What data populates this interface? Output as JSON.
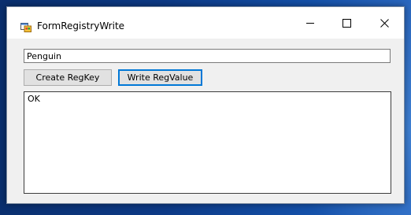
{
  "window": {
    "title": "FormRegistryWrite",
    "icon": "windows-form-icon",
    "controls": {
      "minimize": "minimize-icon",
      "maximize": "maximize-icon",
      "close": "close-icon"
    }
  },
  "form": {
    "input_value": "Penguin",
    "create_button_label": "Create RegKey",
    "write_button_label": "Write RegValue",
    "output_text": "OK"
  },
  "colors": {
    "accent": "#0078d7",
    "window_bg": "#f0f0f0",
    "desktop": "#0d3a86"
  }
}
